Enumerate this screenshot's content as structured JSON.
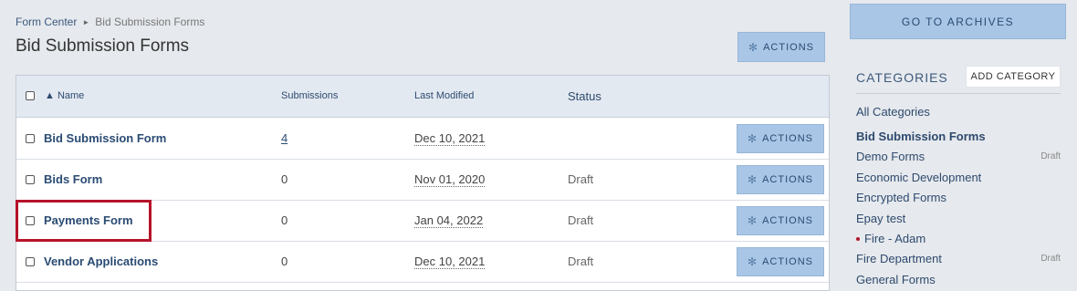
{
  "breadcrumb": {
    "root": "Form Center",
    "current": "Bid Submission Forms"
  },
  "page": {
    "title": "Bid Submission Forms",
    "actions_label": "ACTIONS"
  },
  "table": {
    "headers": {
      "name": "▲ Name",
      "submissions": "Submissions",
      "last_modified": "Last Modified",
      "status": "Status"
    },
    "rows": [
      {
        "name": "Bid Submission Form",
        "submissions": "4",
        "last_modified": "Dec 10, 2021",
        "status": "",
        "actions": "ACTIONS"
      },
      {
        "name": "Bids Form",
        "submissions": "0",
        "last_modified": "Nov 01, 2020",
        "status": "Draft",
        "actions": "ACTIONS"
      },
      {
        "name": "Payments Form",
        "submissions": "0",
        "last_modified": "Jan 04, 2022",
        "status": "Draft",
        "actions": "ACTIONS"
      },
      {
        "name": "Vendor Applications",
        "submissions": "0",
        "last_modified": "Dec 10, 2021",
        "status": "Draft",
        "actions": "ACTIONS"
      }
    ]
  },
  "sidebar": {
    "archives_label": "GO TO ARCHIVES",
    "categories_title": "CATEGORIES",
    "add_category_label": "ADD CATEGORY",
    "categories": [
      {
        "label": "All Categories",
        "badge": ""
      },
      {
        "label": "Bid Submission Forms",
        "badge": ""
      },
      {
        "label": "Demo Forms",
        "badge": "Draft"
      },
      {
        "label": "Economic Development",
        "badge": ""
      },
      {
        "label": "Encrypted Forms",
        "badge": ""
      },
      {
        "label": "Epay test",
        "badge": ""
      },
      {
        "label": "Fire - Adam",
        "badge": ""
      },
      {
        "label": "Fire Department",
        "badge": "Draft"
      },
      {
        "label": "General Forms",
        "badge": ""
      }
    ]
  },
  "colors": {
    "accent_button": "#a9c6e6",
    "link": "#2a4b73",
    "highlight": "#b5132b",
    "background": "#e6e9ed"
  },
  "icons": {
    "actions": "gear-icon",
    "sort": "sort-ascending-icon",
    "unpublished": "red-dot-icon"
  }
}
